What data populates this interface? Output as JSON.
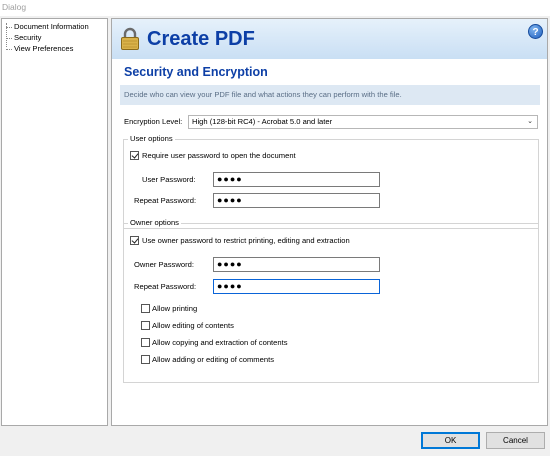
{
  "window": {
    "title": "Dialog"
  },
  "nav": {
    "items": [
      {
        "label": "Document Information"
      },
      {
        "label": "Security"
      },
      {
        "label": "View Preferences"
      }
    ]
  },
  "banner": {
    "title": "Create PDF",
    "help": "?"
  },
  "section": {
    "title": "Security and Encryption",
    "description": "Decide who can view your PDF file and what actions they can perform with the file."
  },
  "encryption": {
    "label": "Encryption Level:",
    "value": "High (128-bit RC4) - Acrobat 5.0 and later"
  },
  "user_options": {
    "title": "User options",
    "require_label": "Require user password to open the document",
    "require_checked": true,
    "password_label": "User Password:",
    "password_value": "●●●●",
    "repeat_label": "Repeat Password:",
    "repeat_value": "●●●●"
  },
  "owner_options": {
    "title": "Owner options",
    "use_label": "Use owner password to restrict printing, editing and extraction",
    "use_checked": true,
    "password_label": "Owner Password:",
    "password_value": "●●●●",
    "repeat_label": "Repeat Password:",
    "repeat_value": "●●●●",
    "permissions": [
      {
        "label": "Allow printing",
        "checked": false
      },
      {
        "label": "Allow editing of contents",
        "checked": false
      },
      {
        "label": "Allow copying and extraction of contents",
        "checked": false
      },
      {
        "label": "Allow adding or editing of comments",
        "checked": false
      }
    ]
  },
  "buttons": {
    "ok": "OK",
    "cancel": "Cancel"
  },
  "colors": {
    "accent": "#0d3fa6",
    "banner_top": "#e6f1fb",
    "banner_bottom": "#c9dff4",
    "focus": "#0a64d8"
  },
  "icons": {
    "banner": "lock-icon",
    "help": "help-icon"
  }
}
